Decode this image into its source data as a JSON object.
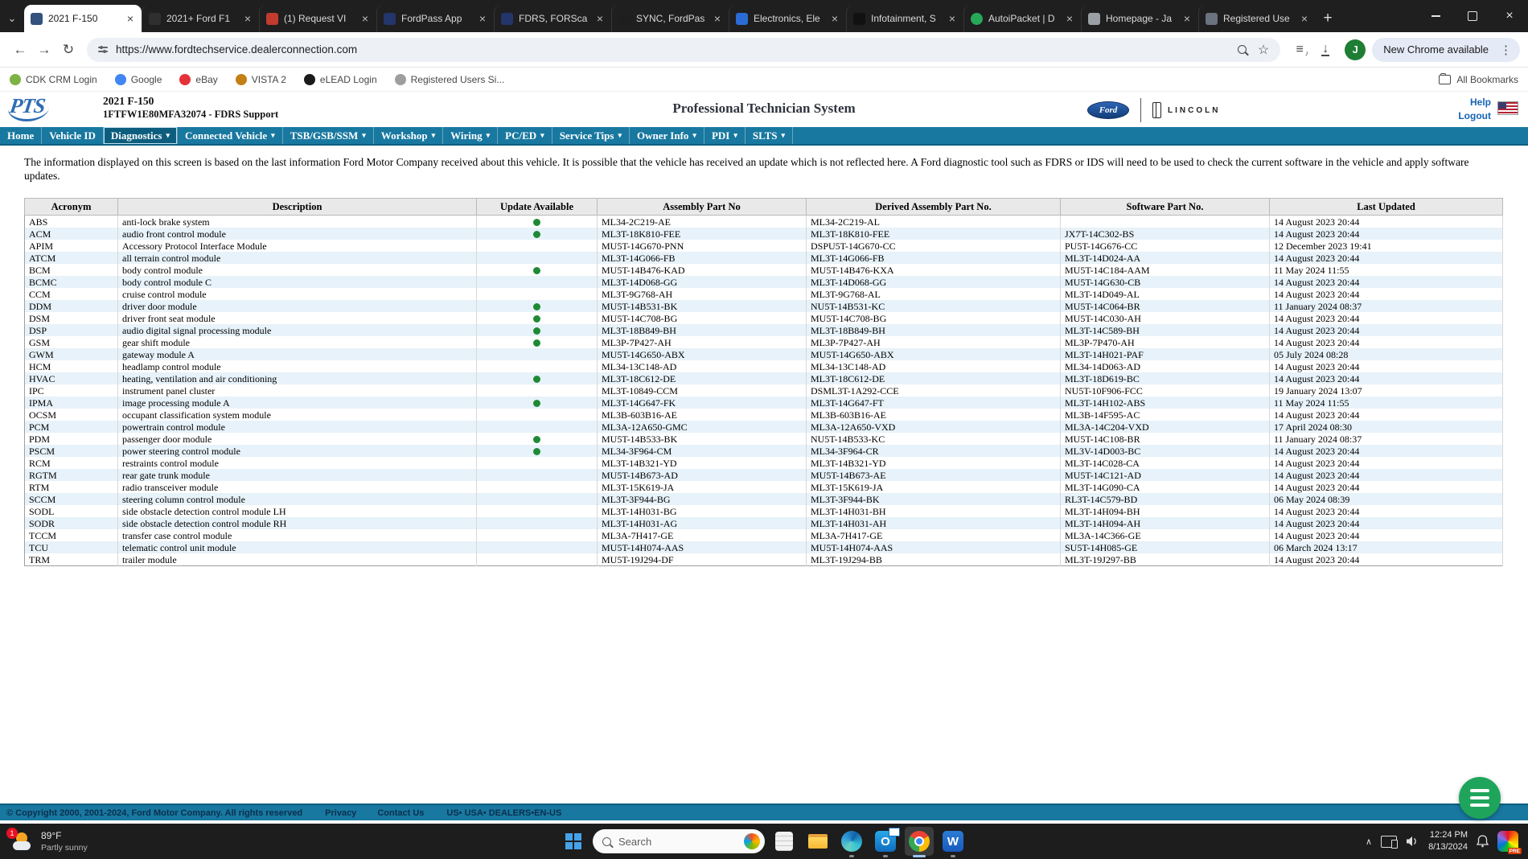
{
  "browser": {
    "tabs": [
      {
        "label": "2021 F-150",
        "favicon_color": "#33527E",
        "shape": "square",
        "active": true
      },
      {
        "label": "2021+ Ford F1",
        "favicon_color": "#2F2F2F",
        "shape": "square",
        "active": false
      },
      {
        "label": "(1) Request VI",
        "favicon_color": "#C23B2E",
        "shape": "square",
        "active": false
      },
      {
        "label": "FordPass App",
        "favicon_color": "#24356B",
        "shape": "square",
        "active": false
      },
      {
        "label": "FDRS, FORSca",
        "favicon_color": "#24356B",
        "shape": "square",
        "active": false
      },
      {
        "label": "SYNC, FordPas",
        "favicon_color": "#1E1E1E",
        "shape": "circle",
        "active": false
      },
      {
        "label": "Electronics, Ele",
        "favicon_color": "#2B6BD4",
        "shape": "square",
        "active": false
      },
      {
        "label": "Infotainment, S",
        "favicon_color": "#111111",
        "shape": "square",
        "active": false
      },
      {
        "label": "AutoiPacket | D",
        "favicon_color": "#27A858",
        "shape": "circle",
        "active": false
      },
      {
        "label": "Homepage - Ja",
        "favicon_color": "#9AA0A6",
        "shape": "square",
        "active": false
      },
      {
        "label": "Registered Use",
        "favicon_color": "#6B7280",
        "shape": "square",
        "active": false
      }
    ],
    "new_tab_label": "+",
    "url": "https://www.fordtechservice.dealerconnection.com",
    "update_pill_label": "New Chrome available",
    "profile_initial": "J",
    "bookmarks": [
      {
        "label": "CDK CRM Login",
        "icon_color": "#7CB342"
      },
      {
        "label": "Google",
        "icon_color": "#4285F4"
      },
      {
        "label": "eBay",
        "icon_color": "#E53238"
      },
      {
        "label": "VISTA 2",
        "icon_color": "#C47F17"
      },
      {
        "label": "eLEAD Login",
        "icon_color": "#1B1B1B"
      },
      {
        "label": "Registered Users Si...",
        "icon_color": "#9E9E9E"
      }
    ],
    "all_bookmarks_label": "All Bookmarks"
  },
  "page": {
    "logo_text": "PTS",
    "vehicle_title": "2021 F-150",
    "vehicle_subtitle": "1FTFW1E80MFA32074 - FDRS Support",
    "app_title": "Professional Technician System",
    "brand_ford": "Ford",
    "brand_lincoln": "LINCOLN",
    "help_label": "Help",
    "logout_label": "Logout",
    "nav_items": [
      {
        "label": "Home",
        "dropdown": false,
        "active": false
      },
      {
        "label": "Vehicle ID",
        "dropdown": false,
        "active": false
      },
      {
        "label": "Diagnostics",
        "dropdown": true,
        "active": true
      },
      {
        "label": "Connected Vehicle",
        "dropdown": true,
        "active": false
      },
      {
        "label": "TSB/GSB/SSM",
        "dropdown": true,
        "active": false
      },
      {
        "label": "Workshop",
        "dropdown": true,
        "active": false
      },
      {
        "label": "Wiring",
        "dropdown": true,
        "active": false
      },
      {
        "label": "PC/ED",
        "dropdown": true,
        "active": false
      },
      {
        "label": "Service Tips",
        "dropdown": true,
        "active": false
      },
      {
        "label": "Owner Info",
        "dropdown": true,
        "active": false
      },
      {
        "label": "PDI",
        "dropdown": true,
        "active": false
      },
      {
        "label": "SLTS",
        "dropdown": true,
        "active": false
      }
    ],
    "info_text": "The information displayed on this screen is based on the last information Ford Motor Company received about this vehicle. It is possible that the vehicle has received an update which is not reflected here. A Ford diagnostic tool such as FDRS or IDS will need to be used to check the current software in the vehicle and apply software updates.",
    "table": {
      "headers": [
        "Acronym",
        "Description",
        "Update Available",
        "Assembly Part No",
        "Derived Assembly Part No.",
        "Software Part No.",
        "Last Updated"
      ],
      "rows": [
        [
          "ABS",
          "anti-lock brake system",
          true,
          "ML34-2C219-AE",
          "ML34-2C219-AL",
          "",
          "14 August 2023 20:44"
        ],
        [
          "ACM",
          "audio front control module",
          true,
          "ML3T-18K810-FEE",
          "ML3T-18K810-FEE",
          "JX7T-14C302-BS",
          "14 August 2023 20:44"
        ],
        [
          "APIM",
          "Accessory Protocol Interface Module",
          false,
          "MU5T-14G670-PNN",
          "DSPU5T-14G670-CC",
          "PU5T-14G676-CC",
          "12 December 2023 19:41"
        ],
        [
          "ATCM",
          "all terrain control module",
          false,
          "ML3T-14G066-FB",
          "ML3T-14G066-FB",
          "ML3T-14D024-AA",
          "14 August 2023 20:44"
        ],
        [
          "BCM",
          "body control module",
          true,
          "MU5T-14B476-KAD",
          "MU5T-14B476-KXA",
          "MU5T-14C184-AAM",
          "11 May 2024 11:55"
        ],
        [
          "BCMC",
          "body control module C",
          false,
          "ML3T-14D068-GG",
          "ML3T-14D068-GG",
          "MU5T-14G630-CB",
          "14 August 2023 20:44"
        ],
        [
          "CCM",
          "cruise control module",
          false,
          "ML3T-9G768-AH",
          "ML3T-9G768-AL",
          "ML3T-14D049-AL",
          "14 August 2023 20:44"
        ],
        [
          "DDM",
          "driver door module",
          true,
          "MU5T-14B531-BK",
          "NU5T-14B531-KC",
          "MU5T-14C064-BR",
          "11 January 2024 08:37"
        ],
        [
          "DSM",
          "driver front seat module",
          true,
          "MU5T-14C708-BG",
          "MU5T-14C708-BG",
          "MU5T-14C030-AH",
          "14 August 2023 20:44"
        ],
        [
          "DSP",
          "audio digital signal processing module",
          true,
          "ML3T-18B849-BH",
          "ML3T-18B849-BH",
          "ML3T-14C589-BH",
          "14 August 2023 20:44"
        ],
        [
          "GSM",
          "gear shift module",
          true,
          "ML3P-7P427-AH",
          "ML3P-7P427-AH",
          "ML3P-7P470-AH",
          "14 August 2023 20:44"
        ],
        [
          "GWM",
          "gateway module A",
          false,
          "MU5T-14G650-ABX",
          "MU5T-14G650-ABX",
          "ML3T-14H021-PAF",
          "05 July 2024 08:28"
        ],
        [
          "HCM",
          "headlamp control module",
          false,
          "ML34-13C148-AD",
          "ML34-13C148-AD",
          "ML34-14D063-AD",
          "14 August 2023 20:44"
        ],
        [
          "HVAC",
          "heating, ventilation and air conditioning",
          true,
          "ML3T-18C612-DE",
          "ML3T-18C612-DE",
          "ML3T-18D619-BC",
          "14 August 2023 20:44"
        ],
        [
          "IPC",
          "instrument panel cluster",
          false,
          "ML3T-10849-CCM",
          "DSML3T-1A292-CCE",
          "NU5T-10F906-FCC",
          "19 January 2024 13:07"
        ],
        [
          "IPMA",
          "image processing module A",
          true,
          "ML3T-14G647-FK",
          "ML3T-14G647-FT",
          "ML3T-14H102-ABS",
          "11 May 2024 11:55"
        ],
        [
          "OCSM",
          "occupant classification system module",
          false,
          "ML3B-603B16-AE",
          "ML3B-603B16-AE",
          "ML3B-14F595-AC",
          "14 August 2023 20:44"
        ],
        [
          "PCM",
          "powertrain control module",
          false,
          "ML3A-12A650-GMC",
          "ML3A-12A650-VXD",
          "ML3A-14C204-VXD",
          "17 April 2024 08:30"
        ],
        [
          "PDM",
          "passenger door module",
          true,
          "MU5T-14B533-BK",
          "NU5T-14B533-KC",
          "MU5T-14C108-BR",
          "11 January 2024 08:37"
        ],
        [
          "PSCM",
          "power steering control module",
          true,
          "ML34-3F964-CM",
          "ML34-3F964-CR",
          "ML3V-14D003-BC",
          "14 August 2023 20:44"
        ],
        [
          "RCM",
          "restraints control module",
          false,
          "ML3T-14B321-YD",
          "ML3T-14B321-YD",
          "ML3T-14C028-CA",
          "14 August 2023 20:44"
        ],
        [
          "RGTM",
          "rear gate trunk module",
          false,
          "MU5T-14B673-AD",
          "MU5T-14B673-AE",
          "MU5T-14C121-AD",
          "14 August 2023 20:44"
        ],
        [
          "RTM",
          "radio transceiver module",
          false,
          "ML3T-15K619-JA",
          "ML3T-15K619-JA",
          "ML3T-14G090-CA",
          "14 August 2023 20:44"
        ],
        [
          "SCCM",
          "steering column control module",
          false,
          "ML3T-3F944-BG",
          "ML3T-3F944-BK",
          "RL3T-14C579-BD",
          "06 May 2024 08:39"
        ],
        [
          "SODL",
          "side obstacle detection control module LH",
          false,
          "ML3T-14H031-BG",
          "ML3T-14H031-BH",
          "ML3T-14H094-BH",
          "14 August 2023 20:44"
        ],
        [
          "SODR",
          "side obstacle detection control module RH",
          false,
          "ML3T-14H031-AG",
          "ML3T-14H031-AH",
          "ML3T-14H094-AH",
          "14 August 2023 20:44"
        ],
        [
          "TCCM",
          "transfer case control module",
          false,
          "ML3A-7H417-GE",
          "ML3A-7H417-GE",
          "ML3A-14C366-GE",
          "14 August 2023 20:44"
        ],
        [
          "TCU",
          "telematic control unit module",
          false,
          "MU5T-14H074-AAS",
          "MU5T-14H074-AAS",
          "SU5T-14H085-GE",
          "06 March 2024 13:17"
        ],
        [
          "TRM",
          "trailer module",
          false,
          "MU5T-19J294-DF",
          "ML3T-19J294-BB",
          "ML3T-19J297-BB",
          "14 August 2023 20:44"
        ]
      ]
    },
    "footer": {
      "copyright": "© Copyright 2000, 2001-2024, Ford Motor Company. All rights reserved",
      "links": [
        "Privacy",
        "Contact Us"
      ],
      "locale": "US• USA• DEALERS•EN-US"
    }
  },
  "taskbar": {
    "weather_temp": "89°F",
    "weather_condition": "Partly sunny",
    "weather_badge": "1",
    "search_placeholder": "Search",
    "icons": [
      "notepad",
      "file-explorer",
      "edge",
      "outlook",
      "chrome",
      "word"
    ],
    "active_icon": "chrome",
    "open_icons": [
      "edge",
      "outlook",
      "word"
    ],
    "time": "12:24 PM",
    "date": "8/13/2024"
  }
}
